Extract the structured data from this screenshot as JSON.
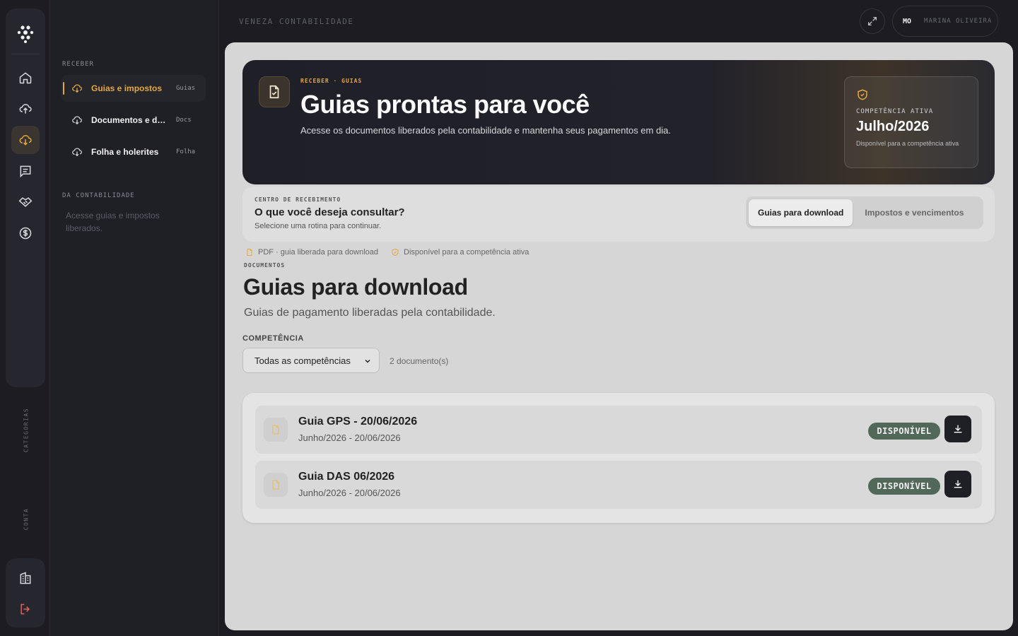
{
  "app": {
    "company": "VENEZA CONTABILIDADE"
  },
  "user": {
    "initials": "MO",
    "name": "MARINA OLIVEIRA"
  },
  "rail": {
    "categories_label": "CATEGORIAS",
    "account_label": "CONTA"
  },
  "sidebar": {
    "section_receive": "RECEBER",
    "items": [
      {
        "label": "Guias e impostos",
        "tag": "Guias"
      },
      {
        "label": "Documentos e declarações",
        "tag": "Docs"
      },
      {
        "label": "Folha e holerites",
        "tag": "Folha"
      }
    ],
    "section_accounting": "DA CONTABILIDADE",
    "accounting_desc": "Acesse guias e impostos liberados."
  },
  "hero": {
    "crumb": "RECEBER · GUIAS",
    "title": "Guias prontas para você",
    "subtitle": "Acesse os documentos liberados pela contabilidade e mantenha seus pagamentos em dia.",
    "competence_label": "COMPETÊNCIA ATIVA",
    "competence_value": "Julho/2026",
    "competence_note": "Disponível para a competência ativa"
  },
  "center": {
    "small": "CENTRO DE RECEBIMENTO",
    "title": "O que você deseja consultar?",
    "subtitle": "Selecione uma rotina para continuar.",
    "tabs": [
      "Guias para download",
      "Impostos e vencimentos"
    ]
  },
  "legend": {
    "pdf": "PDF · guia liberada para download",
    "available": "Disponível para a competência ativa"
  },
  "docs": {
    "label": "DOCUMENTOS",
    "title": "Guias para download",
    "subtitle": "Guias de pagamento liberadas pela contabilidade.",
    "filter_label": "COMPETÊNCIA",
    "filter_value": "Todas as competências",
    "count": "2 documento(s)",
    "rows": [
      {
        "title": "Guia GPS - 20/06/2026",
        "sub": "Junho/2026 - 20/06/2026",
        "status": "DISPONÍVEL"
      },
      {
        "title": "Guia DAS 06/2026",
        "sub": "Junho/2026 - 20/06/2026",
        "status": "DISPONÍVEL"
      }
    ]
  },
  "colors": {
    "accent": "#e3a93c",
    "status_green": "#52695a",
    "danger": "#e0605a"
  }
}
